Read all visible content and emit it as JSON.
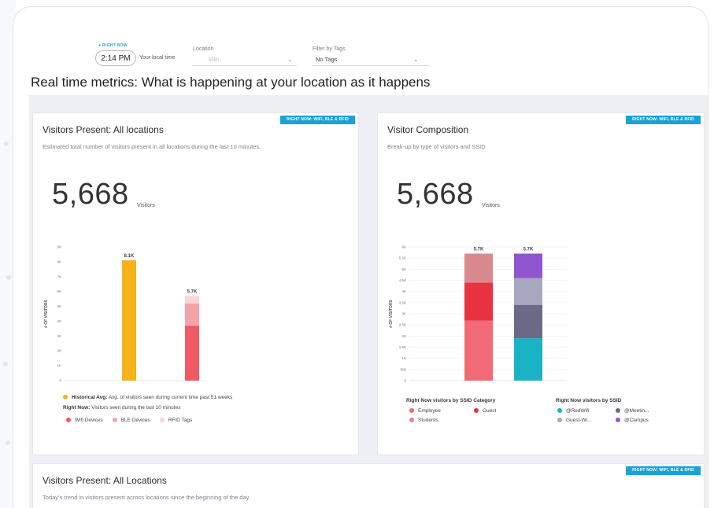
{
  "filters": {
    "right_now_tag": "● RIGHT NOW",
    "time": "2:14 PM",
    "local_time_label": "Your local time",
    "location_label": "Location",
    "location_value": "MBL",
    "tags_label": "Filter by Tags",
    "tags_value": "No Tags"
  },
  "page_title": "Real time metrics: What is happening at your location as it happens",
  "cards": {
    "visitors_present": {
      "badge": "RIGHT NOW: WIFI, BLE & RFID",
      "title": "Visitors Present: All locations",
      "subtitle": "Estimated total number of visitors present in all locations during the last 10 minutes.",
      "count": "5,668",
      "count_unit": "Visitors",
      "legend_hist_bold": "Historical Avg:",
      "legend_hist_text": "Avg. of visitors seen during current time past 51 weeks",
      "legend_now_bold": "Right Now:",
      "legend_now_text": "Visitors seen during the last 10 minutes",
      "legend_items": [
        "Wifi Devices",
        "BLE Devices",
        "RFID Tags"
      ],
      "colors": {
        "historical": "#f5b21d",
        "wifi": "#f05a65",
        "ble": "#f7a2a8",
        "rfid": "#fbd3d6"
      }
    },
    "visitor_composition": {
      "badge": "RIGHT NOW: WIFI, BLE & RFID",
      "title": "Visitor Composition",
      "subtitle": "Break-up by type of visitors and SSID",
      "count": "5,668",
      "count_unit": "Visitors",
      "legend_ssid_cat_title": "Right Now visitors by SSID Category",
      "legend_ssid_cat_items": [
        "Employee",
        "Guest",
        "Students"
      ],
      "legend_ssid_title": "Right Now visitors by SSID",
      "legend_ssid_items": [
        "@RedWifi",
        "@Meetin...",
        "Guest-Wi...",
        "@Campus"
      ],
      "colors": {
        "employee": "#f16a75",
        "guest": "#e8323f",
        "students": "#d9888e",
        "ssid1": "#1ab3c5",
        "ssid2": "#6a6a86",
        "ssid3": "#a7a7bd",
        "ssid4": "#8f56cf"
      }
    },
    "visitors_trend": {
      "badge": "RIGHT NOW: WIFI, BLE & RFID",
      "title": "Visitors Present: All Locations",
      "subtitle": "Today's trend in visitors present across locations since the beginning of the day"
    }
  },
  "chart_data": [
    {
      "type": "bar",
      "title": "Visitors Present: All locations",
      "ylabel": "# OF VISITORS",
      "yticks": [
        "0",
        "1K",
        "2K",
        "3K",
        "4K",
        "5K",
        "6K",
        "7K",
        "8K",
        "9K"
      ],
      "ylim": [
        0,
        9000
      ],
      "grid": false,
      "bars": [
        {
          "label": "Historical Avg",
          "total_label": "8.1K",
          "stack": [
            {
              "name": "Historical Avg",
              "value": 8100
            }
          ]
        },
        {
          "label": "Right Now",
          "total_label": "5.7K",
          "stack": [
            {
              "name": "Wifi Devices",
              "value": 3700
            },
            {
              "name": "BLE Devices",
              "value": 1500
            },
            {
              "name": "RFID Tags",
              "value": 500
            }
          ]
        }
      ]
    },
    {
      "type": "bar",
      "title": "Visitor Composition",
      "ylabel": "# OF VISITORS",
      "yticks": [
        "0",
        "500",
        "1K",
        "1.5K",
        "2K",
        "2.5K",
        "3K",
        "3.5K",
        "4K",
        "4.5K",
        "5K",
        "5.5K",
        "6K"
      ],
      "ylim": [
        0,
        6000
      ],
      "grid": true,
      "bars": [
        {
          "label": "SSID Category",
          "total_label": "5.7K",
          "stack": [
            {
              "name": "Employee",
              "value": 2700
            },
            {
              "name": "Guest",
              "value": 1700
            },
            {
              "name": "Students",
              "value": 1300
            }
          ]
        },
        {
          "label": "SSID",
          "total_label": "5.7K",
          "stack": [
            {
              "name": "@RedWifi",
              "value": 1900
            },
            {
              "name": "@Meetin...",
              "value": 1500
            },
            {
              "name": "Guest-Wi...",
              "value": 1200
            },
            {
              "name": "@Campus",
              "value": 1100
            }
          ]
        }
      ]
    }
  ]
}
